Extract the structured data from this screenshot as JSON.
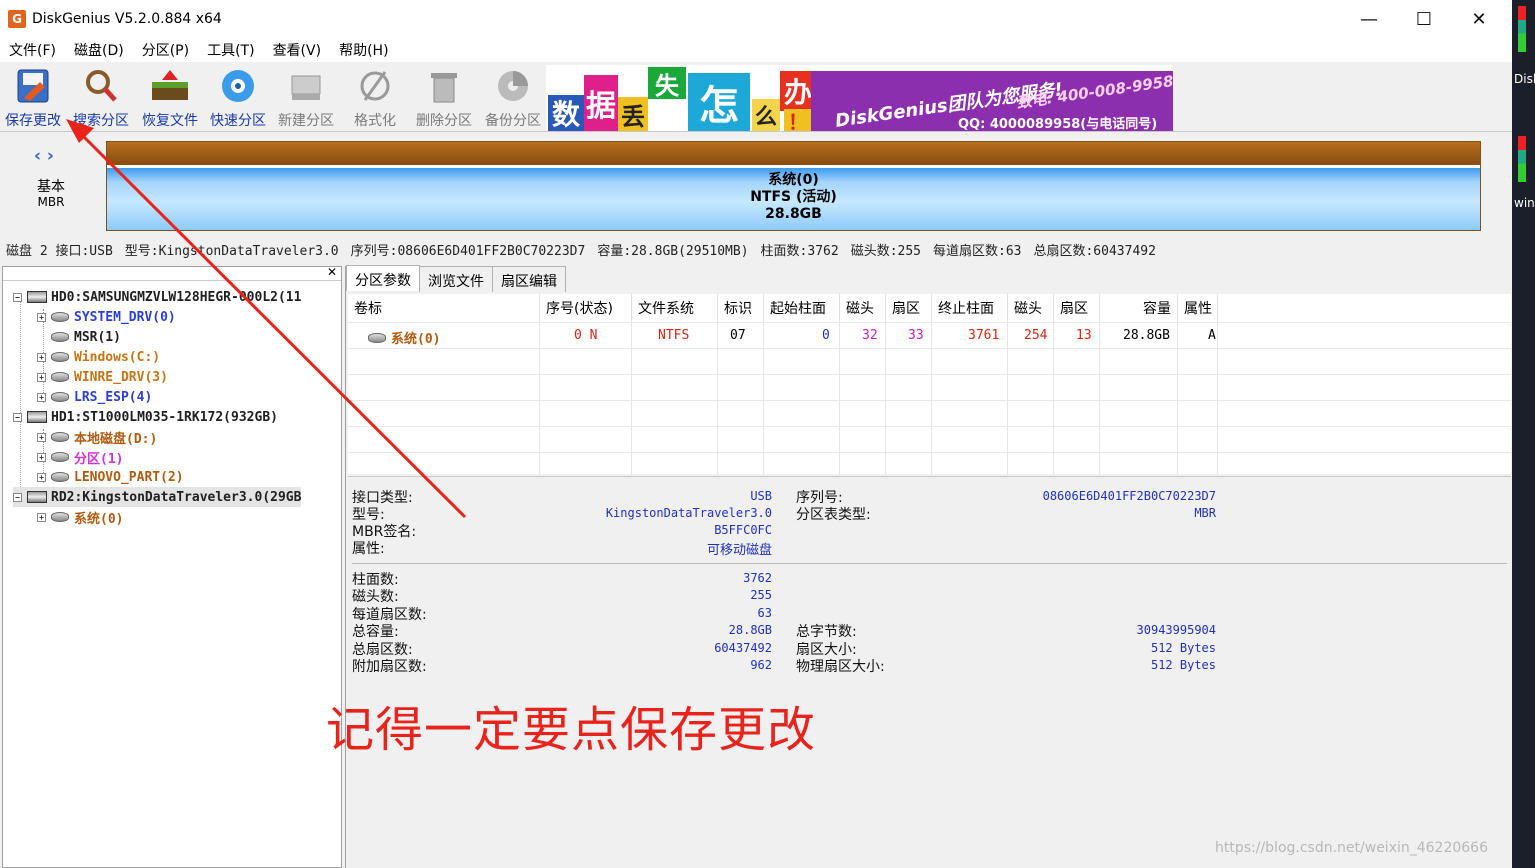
{
  "window": {
    "title": "DiskGenius V5.2.0.884 x64",
    "app_icon": "G",
    "minimize": "—",
    "maximize": "☐",
    "close": "✕"
  },
  "menu": [
    "文件(F)",
    "磁盘(D)",
    "分区(P)",
    "工具(T)",
    "查看(V)",
    "帮助(H)"
  ],
  "toolbar": [
    {
      "label": "保存更改",
      "icon": "save-icon",
      "enabled": true
    },
    {
      "label": "搜索分区",
      "icon": "search-icon",
      "enabled": true
    },
    {
      "label": "恢复文件",
      "icon": "recover-icon",
      "enabled": true
    },
    {
      "label": "快速分区",
      "icon": "quick-partition-icon",
      "enabled": true
    },
    {
      "label": "新建分区",
      "icon": "new-partition-icon",
      "enabled": false
    },
    {
      "label": "格式化",
      "icon": "format-icon",
      "enabled": false
    },
    {
      "label": "删除分区",
      "icon": "delete-icon",
      "enabled": false
    },
    {
      "label": "备份分区",
      "icon": "backup-icon",
      "enabled": false
    }
  ],
  "banner": {
    "chars": [
      "数",
      "据",
      "丢",
      "失",
      "怎",
      "么",
      "办",
      "！"
    ],
    "brand": "DiskGenius团队为您服务!",
    "phone": "致电: 400-008-9958",
    "qq": "QQ: 4000089958(与电话同号)"
  },
  "disk_map": {
    "disk_type": "基本",
    "disk_scheme": "MBR",
    "partition_name": "系统(0)",
    "partition_fs": "NTFS (活动)",
    "partition_size": "28.8GB"
  },
  "disk_info_line": [
    "磁盘 2 接口:USB",
    "型号:KingstonDataTraveler3.0",
    "序列号:08606E6D401FF2B0C70223D7",
    "容量:28.8GB(29510MB)",
    "柱面数:3762",
    "磁头数:255",
    "每道扇区数:63",
    "总扇区数:60437492"
  ],
  "tree": [
    {
      "text": "HD0:SAMSUNGMZVLW128HEGR-000L2(11",
      "type": "disk",
      "color": "dark"
    },
    {
      "text": "SYSTEM_DRV(0)",
      "type": "part",
      "color": "blue"
    },
    {
      "text": "MSR(1)",
      "type": "part",
      "color": "dark"
    },
    {
      "text": "Windows(C:)",
      "type": "part",
      "color": "orange"
    },
    {
      "text": "WINRE_DRV(3)",
      "type": "part",
      "color": "orange"
    },
    {
      "text": "LRS_ESP(4)",
      "type": "part",
      "color": "blue"
    },
    {
      "text": "HD1:ST1000LM035-1RK172(932GB)",
      "type": "disk",
      "color": "dark"
    },
    {
      "text": "本地磁盘(D:)",
      "type": "part",
      "color": "orange"
    },
    {
      "text": "分区(1)",
      "type": "part",
      "color": "magenta"
    },
    {
      "text": "LENOVO_PART(2)",
      "type": "part",
      "color": "orange"
    },
    {
      "text": "RD2:KingstonDataTraveler3.0(29GB",
      "type": "disk",
      "color": "dark"
    },
    {
      "text": "系统(0)",
      "type": "part",
      "color": "orange"
    }
  ],
  "tabs": [
    "分区参数",
    "浏览文件",
    "扇区编辑"
  ],
  "table": {
    "headers": [
      "卷标",
      "序号(状态)",
      "文件系统",
      "标识",
      "起始柱面",
      "磁头",
      "扇区",
      "终止柱面",
      "磁头",
      "扇区",
      "容量",
      "属性"
    ],
    "row": [
      "系统(0)",
      "0 N",
      "NTFS",
      "07",
      "0",
      "32",
      "33",
      "3761",
      "254",
      "13",
      "28.8GB",
      "A"
    ]
  },
  "details": {
    "left1": [
      [
        "接口类型:",
        "USB"
      ],
      [
        "型号:",
        "KingstonDataTraveler3.0"
      ],
      [
        "MBR签名:",
        "B5FFC0FC"
      ],
      [
        "属性:",
        "可移动磁盘"
      ]
    ],
    "right1": [
      [
        "序列号:",
        "08606E6D401FF2B0C70223D7"
      ],
      [
        "分区表类型:",
        "MBR"
      ]
    ],
    "left2": [
      [
        "柱面数:",
        "3762"
      ],
      [
        "磁头数:",
        "255"
      ],
      [
        "每道扇区数:",
        "63"
      ],
      [
        "总容量:",
        "28.8GB"
      ],
      [
        "总扇区数:",
        "60437492"
      ],
      [
        "附加扇区数:",
        "962"
      ]
    ],
    "right2": [
      [
        "总字节数:",
        "30943995904"
      ],
      [
        "扇区大小:",
        "512 Bytes"
      ],
      [
        "物理扇区大小:",
        "512 Bytes"
      ]
    ]
  },
  "annotation": "记得一定要点保存更改",
  "watermark": "https://blog.csdn.net/weixin_46220666",
  "desktop_edge": [
    "Disk",
    "win"
  ],
  "colors": {
    "annotation": "#e8231c",
    "value_blue": "#2030c0",
    "partition_blue": "#3c9bef"
  }
}
